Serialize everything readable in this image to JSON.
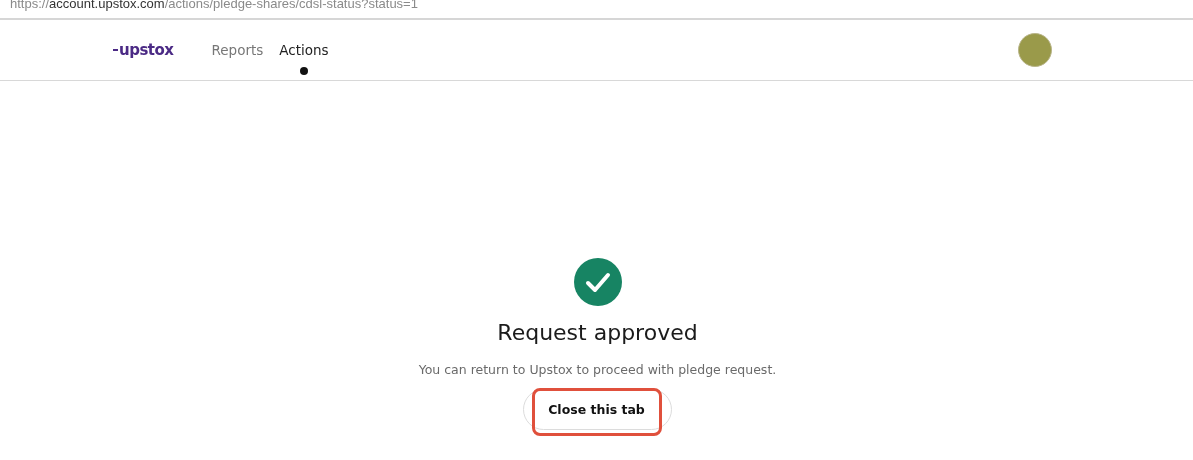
{
  "address_bar": {
    "url": "https://**account.upstox.com**/actions/pledge-shares/cdsl-status?status=1"
  },
  "header": {
    "logo": "upstox",
    "nav": [
      {
        "label": "Reports",
        "selected": false
      },
      {
        "label": "Actions",
        "selected": true
      }
    ]
  },
  "status": {
    "kind": "success",
    "title": "Request approved",
    "message": "You can return to Upstox to proceed with pledge request.",
    "button": {
      "label": "Close this tab",
      "highlighted": true
    }
  }
}
